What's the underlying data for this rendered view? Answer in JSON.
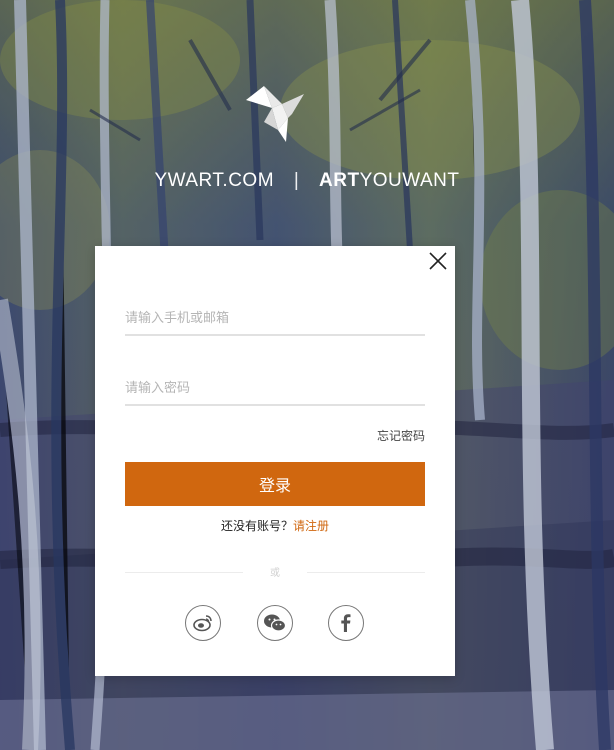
{
  "brand": {
    "site": "YWART.COM",
    "separator": "|",
    "tagline_bold": "ART",
    "tagline_rest": "YOUWANT"
  },
  "login_form": {
    "account_placeholder": "请输入手机或邮箱",
    "password_placeholder": "请输入密码",
    "forgot_label": "忘记密码",
    "submit_label": "登录",
    "no_account_text": "还没有账号？",
    "register_link": "请注册",
    "or_label": "或"
  },
  "social_login": [
    {
      "icon": "weibo-icon"
    },
    {
      "icon": "wechat-icon"
    },
    {
      "icon": "facebook-icon"
    }
  ],
  "colors": {
    "accent": "#d0670f",
    "dialog_bg": "#ffffff",
    "input_underline": "#e1e1e1"
  }
}
